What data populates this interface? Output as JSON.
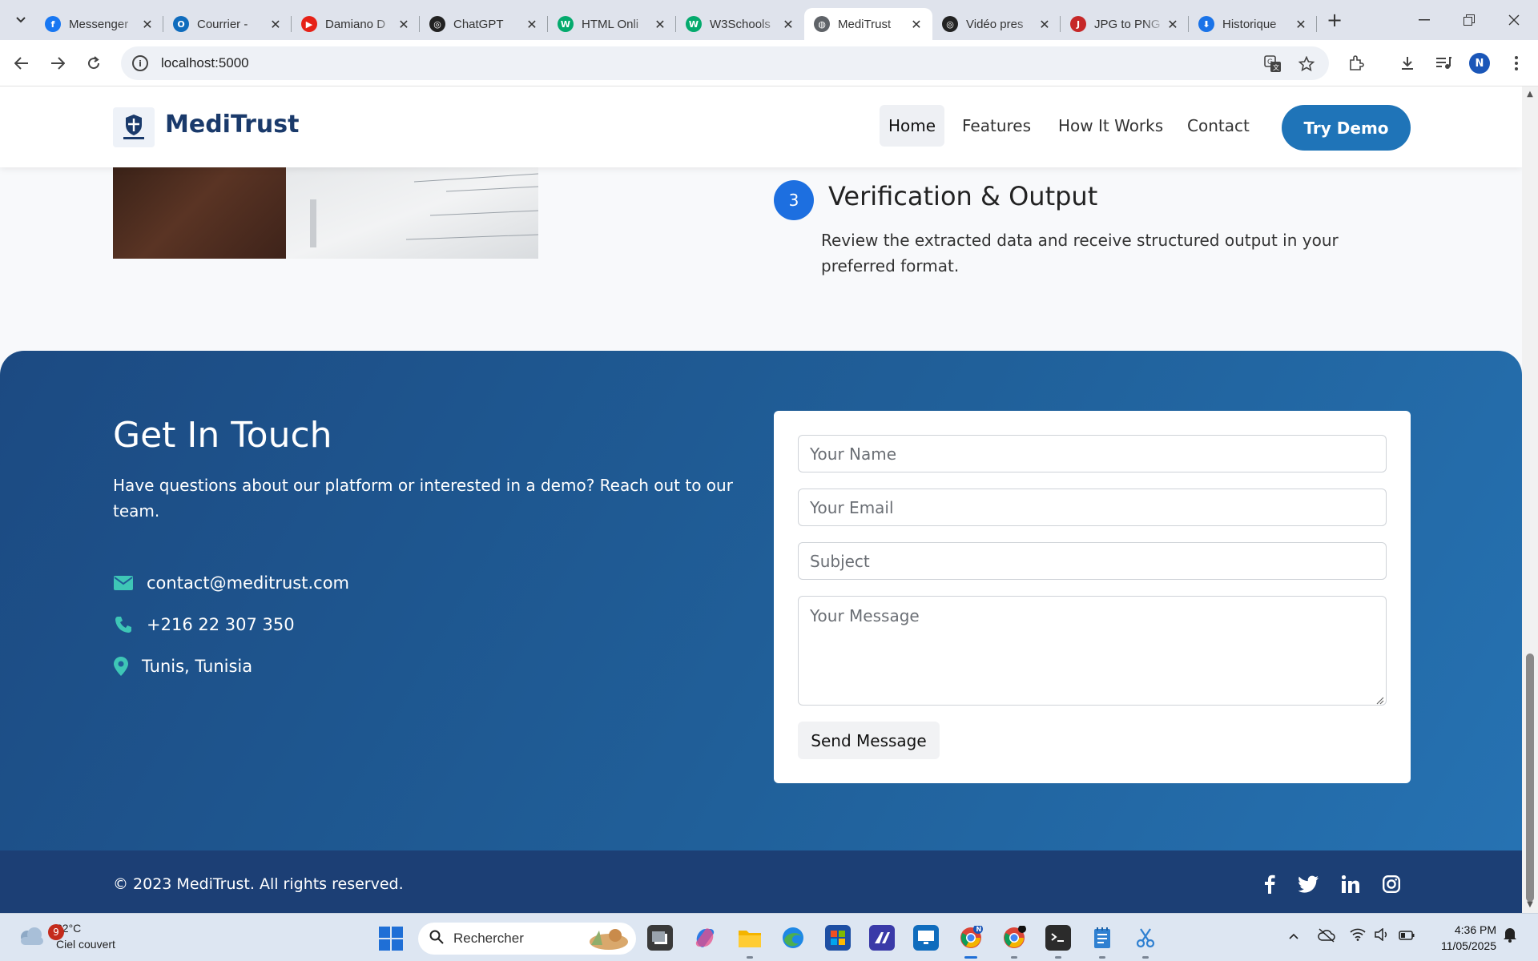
{
  "browser": {
    "tabs": [
      {
        "title": "Messenger",
        "favicon_color": "#1877f2",
        "favicon": "f"
      },
      {
        "title": "Courrier - ",
        "favicon_color": "#0f6cbd",
        "favicon": "O"
      },
      {
        "title": "Damiano D",
        "favicon_color": "#e62117",
        "favicon": "▶"
      },
      {
        "title": "ChatGPT",
        "favicon_color": "#222222",
        "favicon": "◎"
      },
      {
        "title": "HTML Onli",
        "favicon_color": "#04aa6d",
        "favicon": "W"
      },
      {
        "title": "W3Schools",
        "favicon_color": "#04aa6d",
        "favicon": "W"
      },
      {
        "title": "MediTrust",
        "favicon_color": "#5f6368",
        "favicon": "◍"
      },
      {
        "title": "Vidéo pres",
        "favicon_color": "#222222",
        "favicon": "◎"
      },
      {
        "title": "JPG to PNG",
        "favicon_color": "#c62828",
        "favicon": "J"
      },
      {
        "title": "Historique",
        "favicon_color": "#1a73e8",
        "favicon": "⬇"
      }
    ],
    "active_tab_index": 6,
    "url": "localhost:5000"
  },
  "site": {
    "brand": "MediTrust",
    "nav": {
      "home": "Home",
      "features": "Features",
      "how": "How It Works",
      "contact": "Contact",
      "cta": "Try Demo"
    },
    "step": {
      "number": "3",
      "title": "Verification & Output",
      "desc": "Review the extracted data and receive structured output in your preferred format."
    },
    "contact": {
      "title": "Get In Touch",
      "desc": "Have questions about our platform or interested in a demo? Reach out to our team.",
      "email": "contact@meditrust.com",
      "phone": "+216 22 307 350",
      "location": "Tunis, Tunisia",
      "form": {
        "name_placeholder": "Your Name",
        "email_placeholder": "Your Email",
        "subject_placeholder": "Subject",
        "message_placeholder": "Your Message",
        "send": "Send Message"
      }
    },
    "footer": {
      "copyright": "© 2023 MediTrust. All rights reserved.",
      "social": [
        "facebook-icon",
        "twitter-icon",
        "linkedin-icon",
        "instagram-icon"
      ]
    },
    "colors": {
      "brand": "#1a3a6b",
      "cta": "#1f74b8",
      "accent": "#3ec6b6",
      "step": "#1d6fe0",
      "footer": "#1c3f75"
    }
  },
  "taskbar": {
    "weather_badge": "9",
    "temperature": "22°C",
    "condition": "Ciel couvert",
    "search_placeholder": "Rechercher",
    "time": "4:36 PM",
    "date": "11/05/2025"
  }
}
